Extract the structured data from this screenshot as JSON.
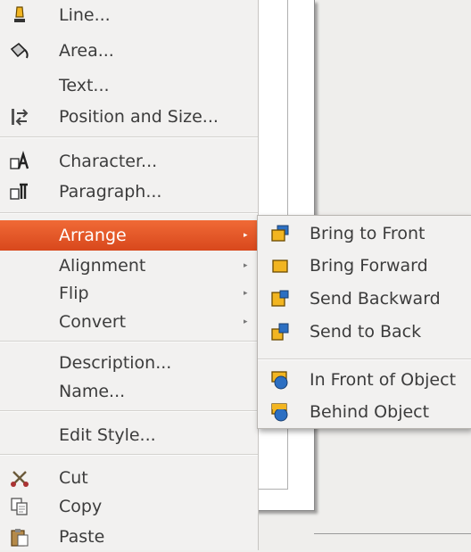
{
  "menu": {
    "items": [
      {
        "label": "Line...",
        "icon": "line-icon"
      },
      {
        "label": "Area...",
        "icon": "area-icon"
      },
      {
        "label": "Text...",
        "icon": ""
      },
      {
        "label": "Position and Size...",
        "icon": "position-size-icon"
      },
      {
        "label": "Character...",
        "icon": "character-icon"
      },
      {
        "label": "Paragraph...",
        "icon": "paragraph-icon"
      },
      {
        "label": "Arrange",
        "icon": "",
        "submenu": true,
        "highlighted": true
      },
      {
        "label": "Alignment",
        "icon": "",
        "submenu": true
      },
      {
        "label": "Flip",
        "icon": "",
        "submenu": true
      },
      {
        "label": "Convert",
        "icon": "",
        "submenu": true
      },
      {
        "label": "Description...",
        "icon": ""
      },
      {
        "label": "Name...",
        "icon": ""
      },
      {
        "label": "Edit Style...",
        "icon": ""
      },
      {
        "label": "Cut",
        "icon": "scissors-icon"
      },
      {
        "label": "Copy",
        "icon": "copy-icon"
      },
      {
        "label": "Paste",
        "icon": "paste-icon"
      }
    ],
    "submenu_arrow": "▸"
  },
  "arrange_submenu": {
    "items": [
      {
        "label": "Bring to Front",
        "icon": "bring-to-front-icon"
      },
      {
        "label": "Bring Forward",
        "icon": "bring-forward-icon"
      },
      {
        "label": "Send Backward",
        "icon": "send-backward-icon"
      },
      {
        "label": "Send to Back",
        "icon": "send-to-back-icon"
      },
      {
        "label": "In Front of Object",
        "icon": "in-front-of-object-icon"
      },
      {
        "label": "Behind Object",
        "icon": "behind-object-icon"
      }
    ]
  },
  "colors": {
    "highlight": "#e2532a",
    "icon_yellow": "#f2b521",
    "icon_blue": "#2c6fc2"
  }
}
